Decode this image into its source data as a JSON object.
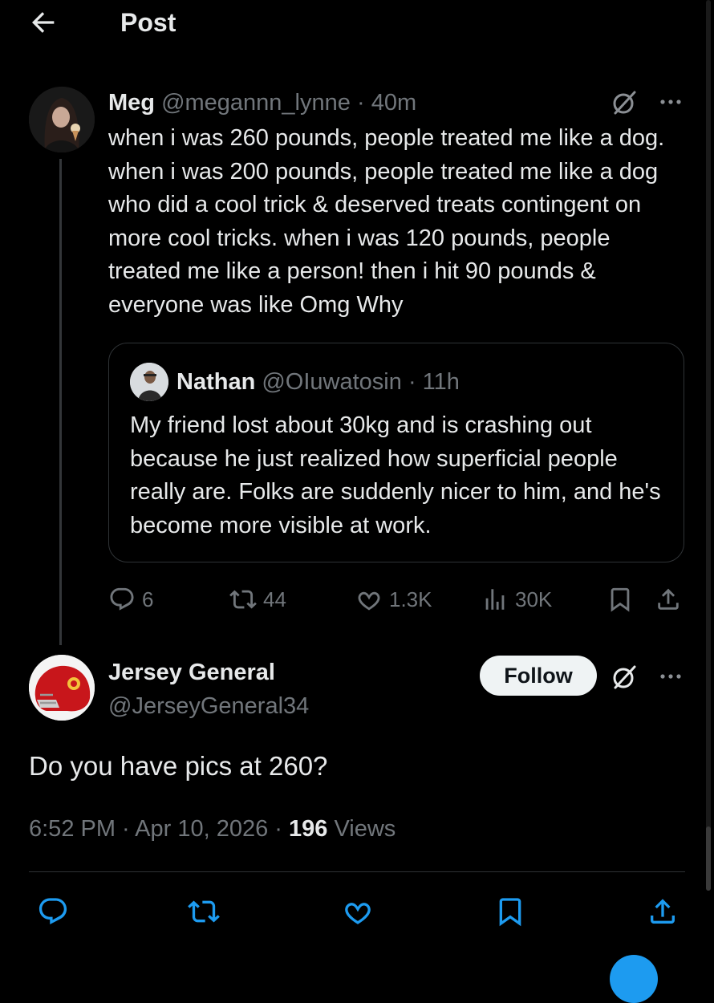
{
  "header": {
    "title": "Post"
  },
  "post": {
    "author_name": "Meg",
    "handle": "@megannn_lynne",
    "separator": "·",
    "time": "40m",
    "text": "when i was 260 pounds, people treated me like a dog. when i was 200 pounds, people treated me like a dog who did a cool trick & deserved treats contingent on more cool tricks. when i was 120 pounds, people treated me like a person! then i hit 90 pounds & everyone was like Omg Why",
    "quote": {
      "author_name": "Nathan",
      "handle": "@OIuwatosin",
      "separator": "·",
      "time": "11h",
      "text": "My friend lost about 30kg and is crashing out because he just realized how superficial people really are. Folks are suddenly nicer to him, and he's become more visible at work."
    },
    "stats": {
      "replies": "6",
      "reposts": "44",
      "likes": "1.3K",
      "views": "30K"
    }
  },
  "reply": {
    "author_name": "Jersey General",
    "handle": "@JerseyGeneral34",
    "follow_label": "Follow",
    "text": "Do you have pics at 260?",
    "timestamp": "6:52 PM · Apr 10, 2026 · ",
    "views_count": "196",
    "views_label": "Views"
  },
  "icons": {
    "back": "arrow-left-icon",
    "grok": "grok-icon",
    "more": "more-icon",
    "reply": "reply-icon",
    "repost": "repost-icon",
    "like": "heart-icon",
    "views": "views-icon",
    "bookmark": "bookmark-icon",
    "share": "share-icon"
  },
  "colors": {
    "background": "#000000",
    "text": "#e7e9ea",
    "muted": "#71767b",
    "border": "#2f3336",
    "accent": "#1d9bf0"
  }
}
